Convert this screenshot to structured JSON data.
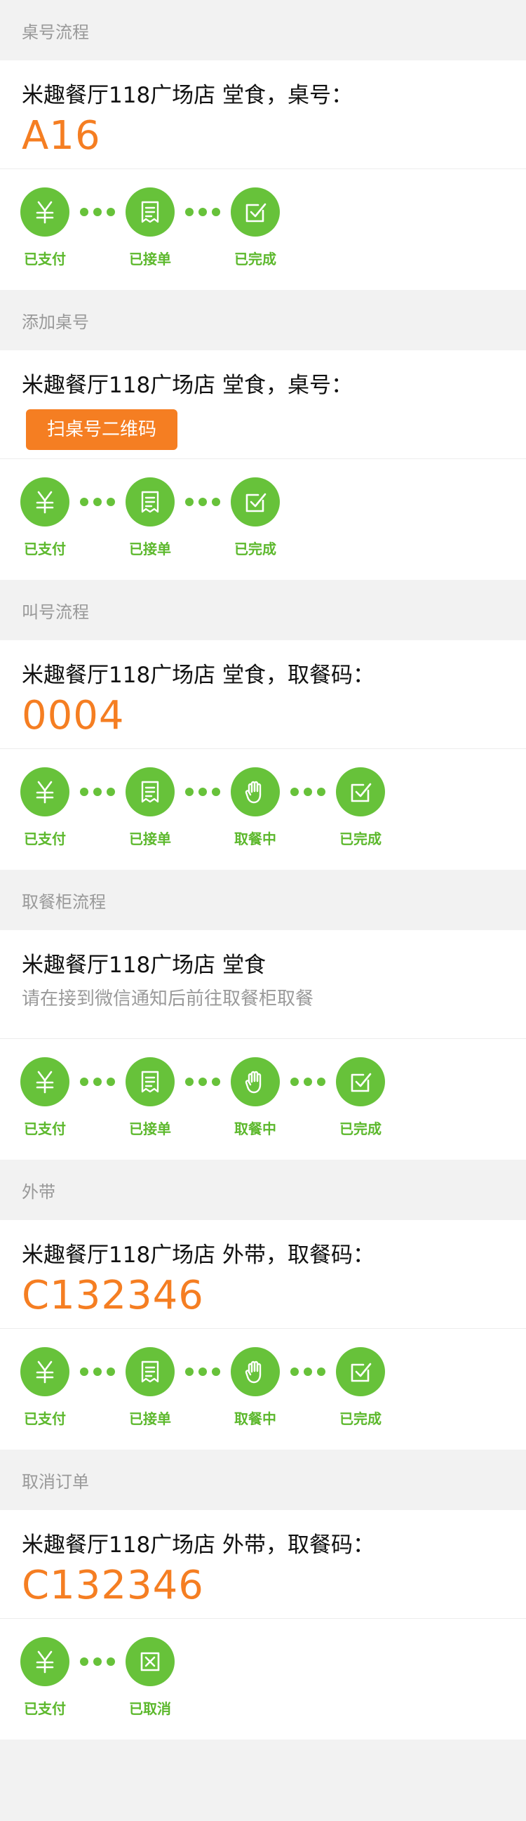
{
  "sections": [
    {
      "header": "桌号流程",
      "title": "米趣餐厅118广场店 堂食，桌号：",
      "code": "A16",
      "steps": [
        {
          "label": "已支付",
          "icon": "yen-icon"
        },
        {
          "label": "已接单",
          "icon": "receipt-icon"
        },
        {
          "label": "已完成",
          "icon": "checkbox-icon"
        }
      ]
    },
    {
      "header": "添加桌号",
      "title": "米趣餐厅118广场店 堂食，桌号：",
      "button": "扫桌号二维码",
      "steps": [
        {
          "label": "已支付",
          "icon": "yen-icon"
        },
        {
          "label": "已接单",
          "icon": "receipt-icon"
        },
        {
          "label": "已完成",
          "icon": "checkbox-icon"
        }
      ]
    },
    {
      "header": "叫号流程",
      "title": "米趣餐厅118广场店 堂食，取餐码：",
      "code": "0004",
      "steps": [
        {
          "label": "已支付",
          "icon": "yen-icon"
        },
        {
          "label": "已接单",
          "icon": "receipt-icon"
        },
        {
          "label": "取餐中",
          "icon": "hand-icon"
        },
        {
          "label": "已完成",
          "icon": "checkbox-icon"
        }
      ]
    },
    {
      "header": "取餐柜流程",
      "title": "米趣餐厅118广场店 堂食",
      "note": "请在接到微信通知后前往取餐柜取餐",
      "steps": [
        {
          "label": "已支付",
          "icon": "yen-icon"
        },
        {
          "label": "已接单",
          "icon": "receipt-icon"
        },
        {
          "label": "取餐中",
          "icon": "hand-icon"
        },
        {
          "label": "已完成",
          "icon": "checkbox-icon"
        }
      ]
    },
    {
      "header": "外带",
      "title": "米趣餐厅118广场店 外带，取餐码：",
      "code": "C132346",
      "steps": [
        {
          "label": "已支付",
          "icon": "yen-icon"
        },
        {
          "label": "已接单",
          "icon": "receipt-icon"
        },
        {
          "label": "取餐中",
          "icon": "hand-icon"
        },
        {
          "label": "已完成",
          "icon": "checkbox-icon"
        }
      ]
    },
    {
      "header": "取消订单",
      "title": "米趣餐厅118广场店 外带，取餐码：",
      "code": "C132346",
      "steps": [
        {
          "label": "已支付",
          "icon": "yen-icon"
        },
        {
          "label": "已取消",
          "icon": "cancel-icon"
        }
      ]
    }
  ],
  "colors": {
    "accent": "#f57e22",
    "success": "#67c23a",
    "background": "#f2f2f2"
  }
}
